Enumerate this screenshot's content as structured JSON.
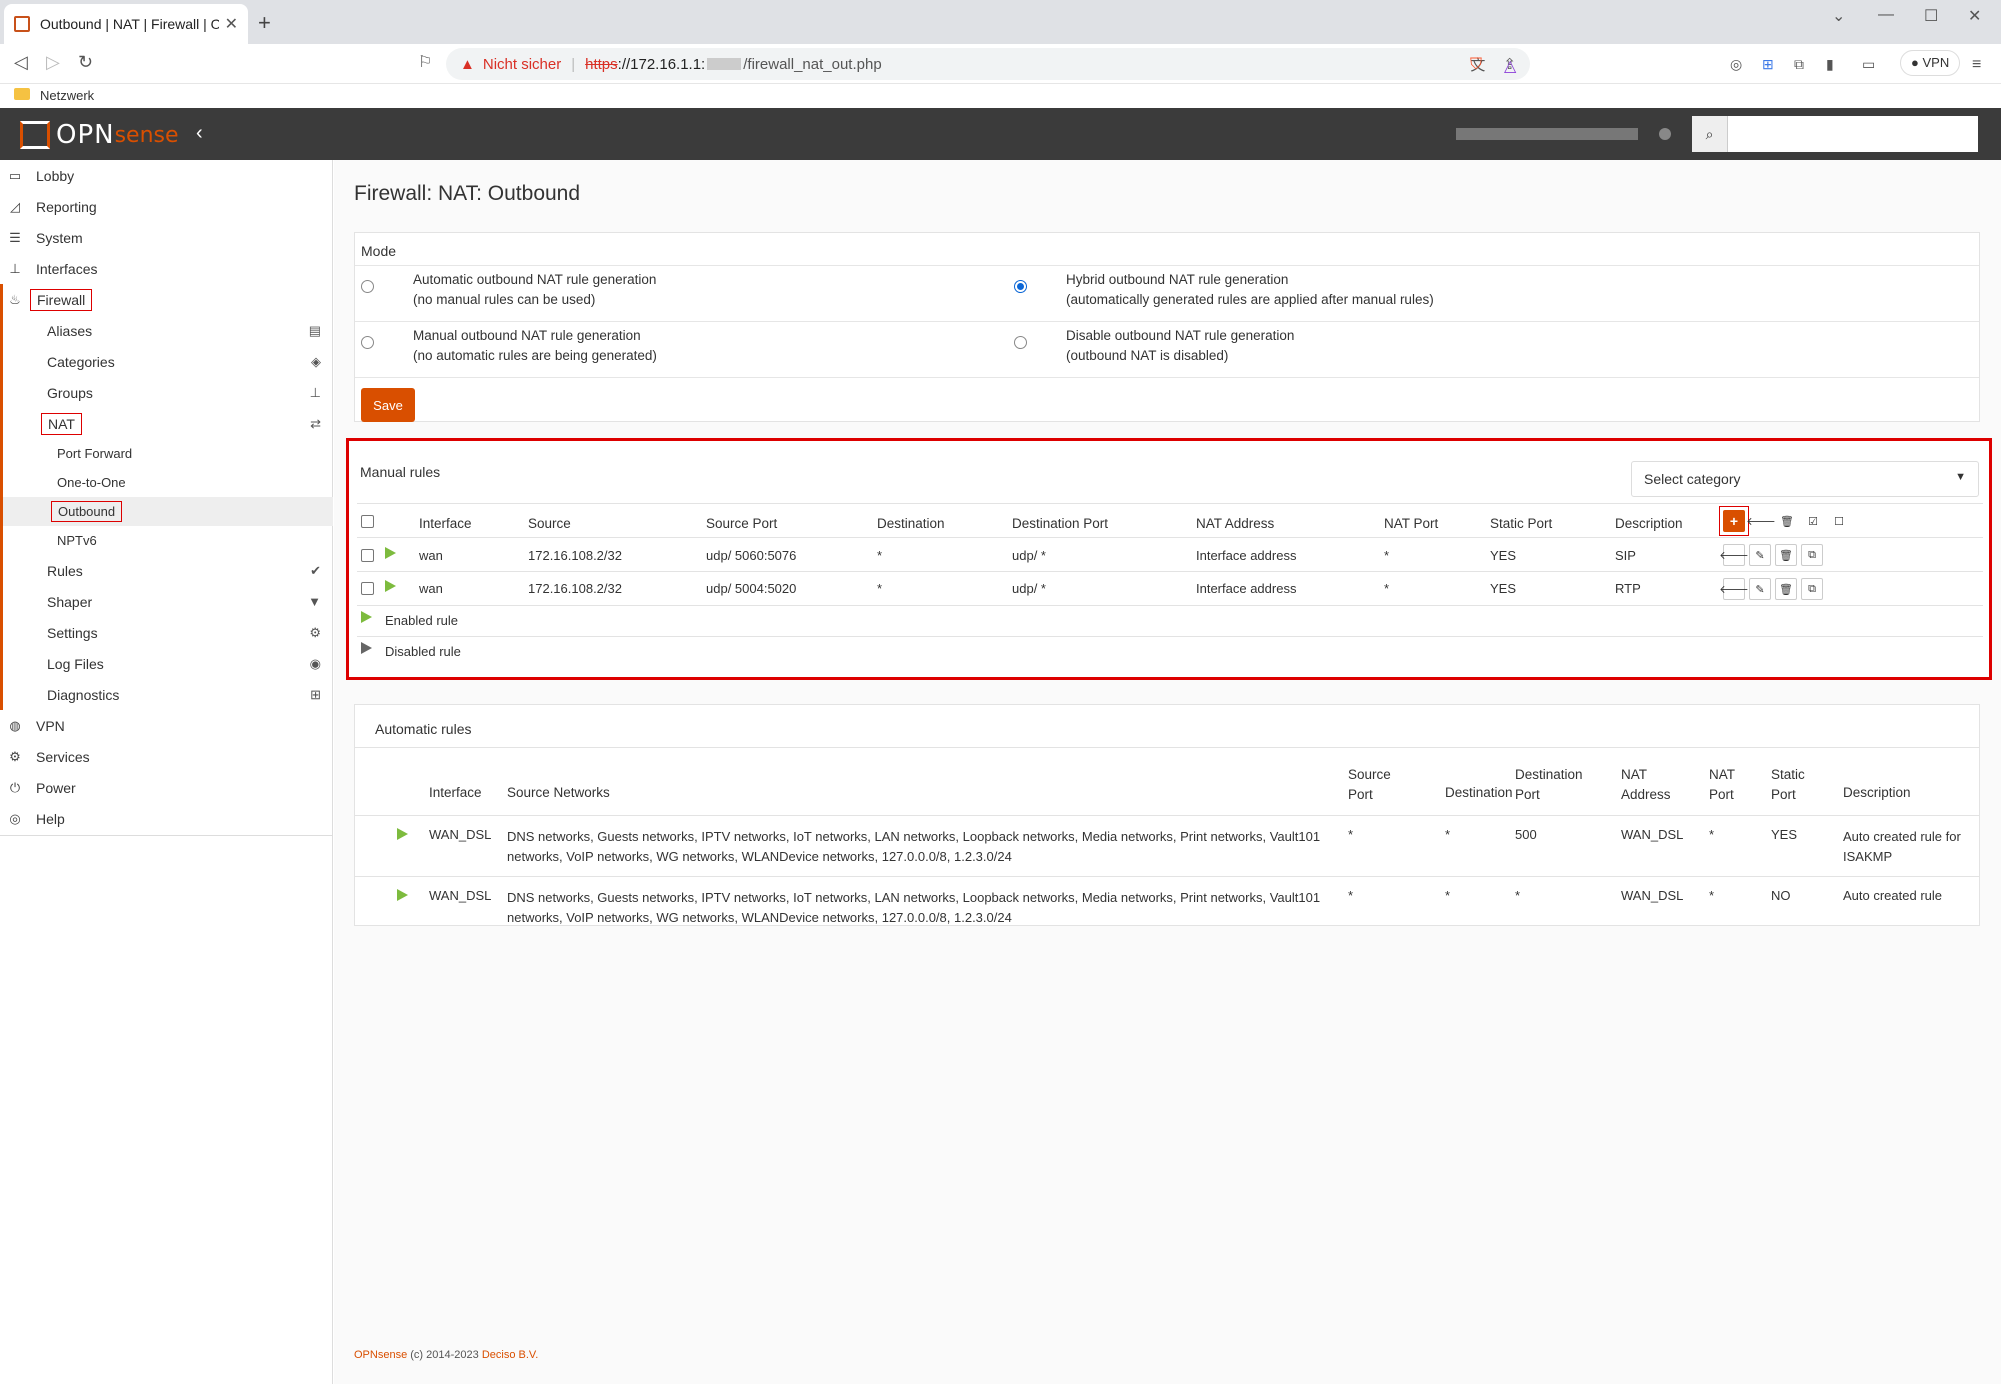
{
  "browser": {
    "tab_title": "Outbound | NAT | Firewall | OPNsense",
    "new_tab": "+",
    "warning": "Nicht sicher",
    "url_scheme": "https",
    "url_host": "://172.16.1.1:",
    "url_path": "/firewall_nat_out.php",
    "vpn_label": "VPN",
    "bookmark": "Netzwerk"
  },
  "app": {
    "logo_opn": "OPN",
    "logo_sense": "sense"
  },
  "sidebar": {
    "items": [
      {
        "label": "Lobby",
        "icon": "laptop-icon"
      },
      {
        "label": "Reporting",
        "icon": "chart-icon"
      },
      {
        "label": "System",
        "icon": "server-icon"
      },
      {
        "label": "Interfaces",
        "icon": "sitemap-icon"
      },
      {
        "label": "Firewall",
        "icon": "fire-icon"
      }
    ],
    "firewall_children": [
      "Aliases",
      "Categories",
      "Groups",
      "NAT"
    ],
    "nat_children": [
      "Port Forward",
      "One-to-One",
      "Outbound",
      "NPTv6"
    ],
    "firewall_more": [
      "Rules",
      "Shaper",
      "Settings",
      "Log Files",
      "Diagnostics"
    ],
    "bottom": [
      {
        "label": "VPN",
        "icon": "globe-icon"
      },
      {
        "label": "Services",
        "icon": "cog-icon"
      },
      {
        "label": "Power",
        "icon": "plug-icon"
      },
      {
        "label": "Help",
        "icon": "lifebuoy-icon"
      }
    ]
  },
  "page": {
    "title": "Firewall: NAT: Outbound",
    "mode_header": "Mode",
    "modes": [
      {
        "l1": "Automatic outbound NAT rule generation",
        "l2": "(no manual rules can be used)",
        "selected": false
      },
      {
        "l1": "Hybrid outbound NAT rule generation",
        "l2": "(automatically generated rules are applied after manual rules)",
        "selected": true
      },
      {
        "l1": "Manual outbound NAT rule generation",
        "l2": "(no automatic rules are being generated)",
        "selected": false
      },
      {
        "l1": "Disable outbound NAT rule generation",
        "l2": "(outbound NAT is disabled)",
        "selected": false
      }
    ],
    "save_label": "Save"
  },
  "manual": {
    "title": "Manual rules",
    "select_category": "Select category",
    "headers": [
      "Interface",
      "Source",
      "Source Port",
      "Destination",
      "Destination Port",
      "NAT Address",
      "NAT Port",
      "Static Port",
      "Description"
    ],
    "rows": [
      [
        "wan",
        "172.16.108.2/32",
        "udp/ 5060:5076",
        "*",
        "udp/ *",
        "Interface address",
        "*",
        "YES",
        "SIP"
      ],
      [
        "wan",
        "172.16.108.2/32",
        "udp/ 5004:5020",
        "*",
        "udp/ *",
        "Interface address",
        "*",
        "YES",
        "RTP"
      ]
    ],
    "legend_enabled": "Enabled rule",
    "legend_disabled": "Disabled rule"
  },
  "automatic": {
    "title": "Automatic rules",
    "headers": {
      "interface": "Interface",
      "source_networks": "Source Networks",
      "source_port_1": "Source",
      "source_port_2": "Port",
      "destination": "Destination",
      "dest_port_1": "Destination",
      "dest_port_2": "Port",
      "nat_address_1": "NAT",
      "nat_address_2": "Address",
      "nat_port_1": "NAT",
      "nat_port_2": "Port",
      "static_port_1": "Static",
      "static_port_2": "Port",
      "description": "Description"
    },
    "rows": [
      {
        "interface": "WAN_DSL",
        "net1": "DNS networks, Guests networks, IPTV networks, IoT networks, LAN networks, Loopback networks, Media networks, Print networks, Vault101",
        "net2": "networks, VoIP networks, WG networks, WLANDevice networks, 127.0.0.0/8, 1.2.3.0/24",
        "src_port": "*",
        "dest": "*",
        "dest_port": "500",
        "nat_addr": "WAN_DSL",
        "nat_port": "*",
        "static": "YES",
        "desc1": "Auto created rule for",
        "desc2": "ISAKMP"
      },
      {
        "interface": "WAN_DSL",
        "net1": "DNS networks, Guests networks, IPTV networks, IoT networks, LAN networks, Loopback networks, Media networks, Print networks, Vault101",
        "net2": "networks, VoIP networks, WG networks, WLANDevice networks, 127.0.0.0/8, 1.2.3.0/24",
        "src_port": "*",
        "dest": "*",
        "dest_port": "*",
        "nat_addr": "WAN_DSL",
        "nat_port": "*",
        "static": "NO",
        "desc1": "Auto created rule",
        "desc2": ""
      }
    ]
  },
  "footer": {
    "brand": "OPNsense",
    "copy": " (c) 2014-2023 ",
    "company": "Deciso B.V."
  },
  "colors": {
    "accent": "#d94f00",
    "header": "#3b3b3b",
    "enabled": "#7dbb3e",
    "highlight": "#dd0000"
  }
}
